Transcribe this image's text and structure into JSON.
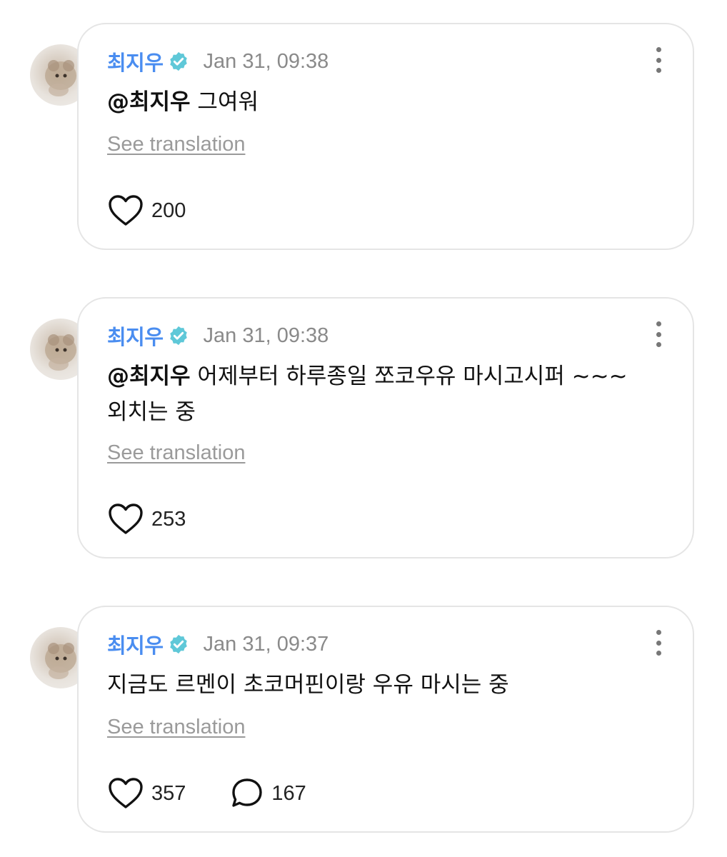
{
  "posts": [
    {
      "author": "최지우",
      "verified": true,
      "timestamp": "Jan 31, 09:38",
      "mention": "@최지우",
      "text": "그여워",
      "translation_label": "See translation",
      "likes": "200",
      "replies": null
    },
    {
      "author": "최지우",
      "verified": true,
      "timestamp": "Jan 31, 09:38",
      "mention": "@최지우",
      "text": "어제부터 하루종일 쪼코우유 마시고시퍼 ~~~ 외치는 중",
      "translation_label": "See translation",
      "likes": "253",
      "replies": null
    },
    {
      "author": "최지우",
      "verified": true,
      "timestamp": "Jan 31, 09:37",
      "mention": "",
      "text": "지금도 르멘이 초코머핀이랑 우유 마시는 중",
      "translation_label": "See translation",
      "likes": "357",
      "replies": "167"
    }
  ],
  "colors": {
    "author": "#4a8df0",
    "verified_badge": "#5fc8d8",
    "timestamp": "#8a8a8a",
    "translate": "#9a9a9a",
    "card_border": "#e5e5e5"
  },
  "icons": {
    "verified": "verified-badge-icon",
    "more": "more-vertical-icon",
    "like": "heart-icon",
    "reply": "comment-bubble-icon"
  }
}
